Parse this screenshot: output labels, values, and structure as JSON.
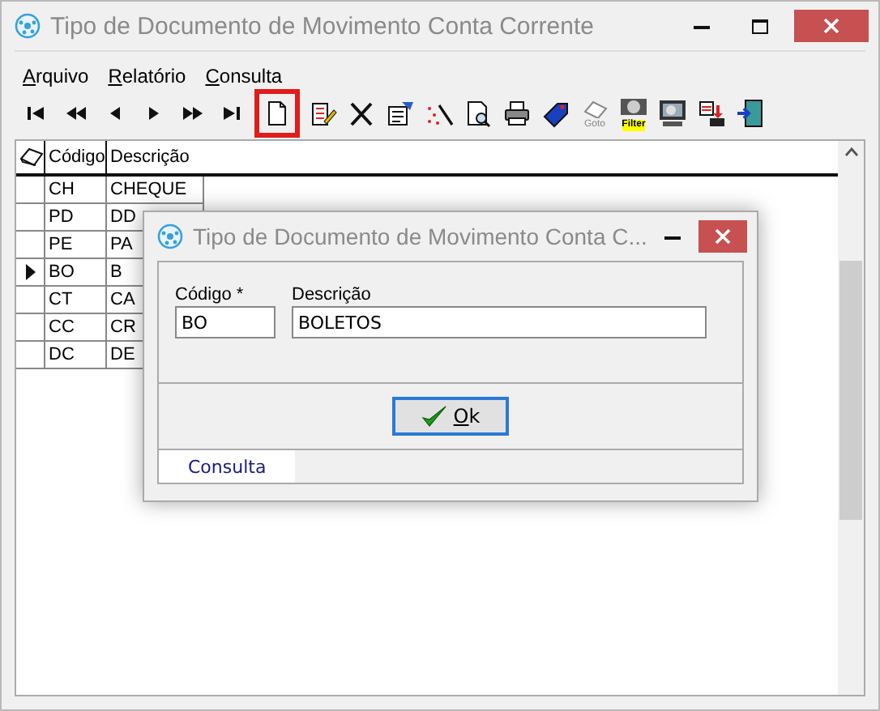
{
  "window": {
    "title": "Tipo de Documento de Movimento Conta Corrente"
  },
  "menu": [
    "Arquivo",
    "Relatório",
    "Consulta"
  ],
  "toolbar": [
    {
      "kind": "first",
      "highlighted": false
    },
    {
      "kind": "rewind",
      "highlighted": false
    },
    {
      "kind": "prev",
      "highlighted": false
    },
    {
      "kind": "next",
      "highlighted": false
    },
    {
      "kind": "forward",
      "highlighted": false
    },
    {
      "kind": "last",
      "highlighted": false
    },
    {
      "kind": "new",
      "highlighted": true
    },
    {
      "kind": "edit",
      "highlighted": false
    },
    {
      "kind": "delete",
      "highlighted": false
    },
    {
      "kind": "properties",
      "highlighted": false
    },
    {
      "kind": "wand",
      "highlighted": false
    },
    {
      "kind": "preview",
      "highlighted": false
    },
    {
      "kind": "print",
      "highlighted": false
    },
    {
      "kind": "tag",
      "highlighted": false
    },
    {
      "kind": "goto",
      "label": "Goto",
      "highlighted": false
    },
    {
      "kind": "filter",
      "label": "Filter",
      "highlighted": false
    },
    {
      "kind": "screen",
      "highlighted": false
    },
    {
      "kind": "save",
      "highlighted": false
    },
    {
      "kind": "exit",
      "highlighted": false
    }
  ],
  "table": {
    "columns": [
      "Código",
      "Descrição"
    ],
    "rows": [
      {
        "code": "CH",
        "description": "CHEQUE",
        "selected": false
      },
      {
        "code": "PD",
        "description": "DD",
        "selected": false
      },
      {
        "code": "PE",
        "description": "PA",
        "selected": false
      },
      {
        "code": "BO",
        "description": "B",
        "selected": true
      },
      {
        "code": "CT",
        "description": "CA",
        "selected": false
      },
      {
        "code": "CC",
        "description": "CR",
        "selected": false
      },
      {
        "code": "DC",
        "description": "DE",
        "selected": false
      }
    ]
  },
  "dialog": {
    "title": "Tipo de Documento de Movimento Conta C...",
    "fields": [
      {
        "label": "Código *",
        "value": "BO"
      },
      {
        "label": "Descrição",
        "value": "BOLETOS"
      }
    ],
    "button": "Ok",
    "tabs": [
      {
        "label": "Consulta",
        "selected": true
      }
    ]
  }
}
